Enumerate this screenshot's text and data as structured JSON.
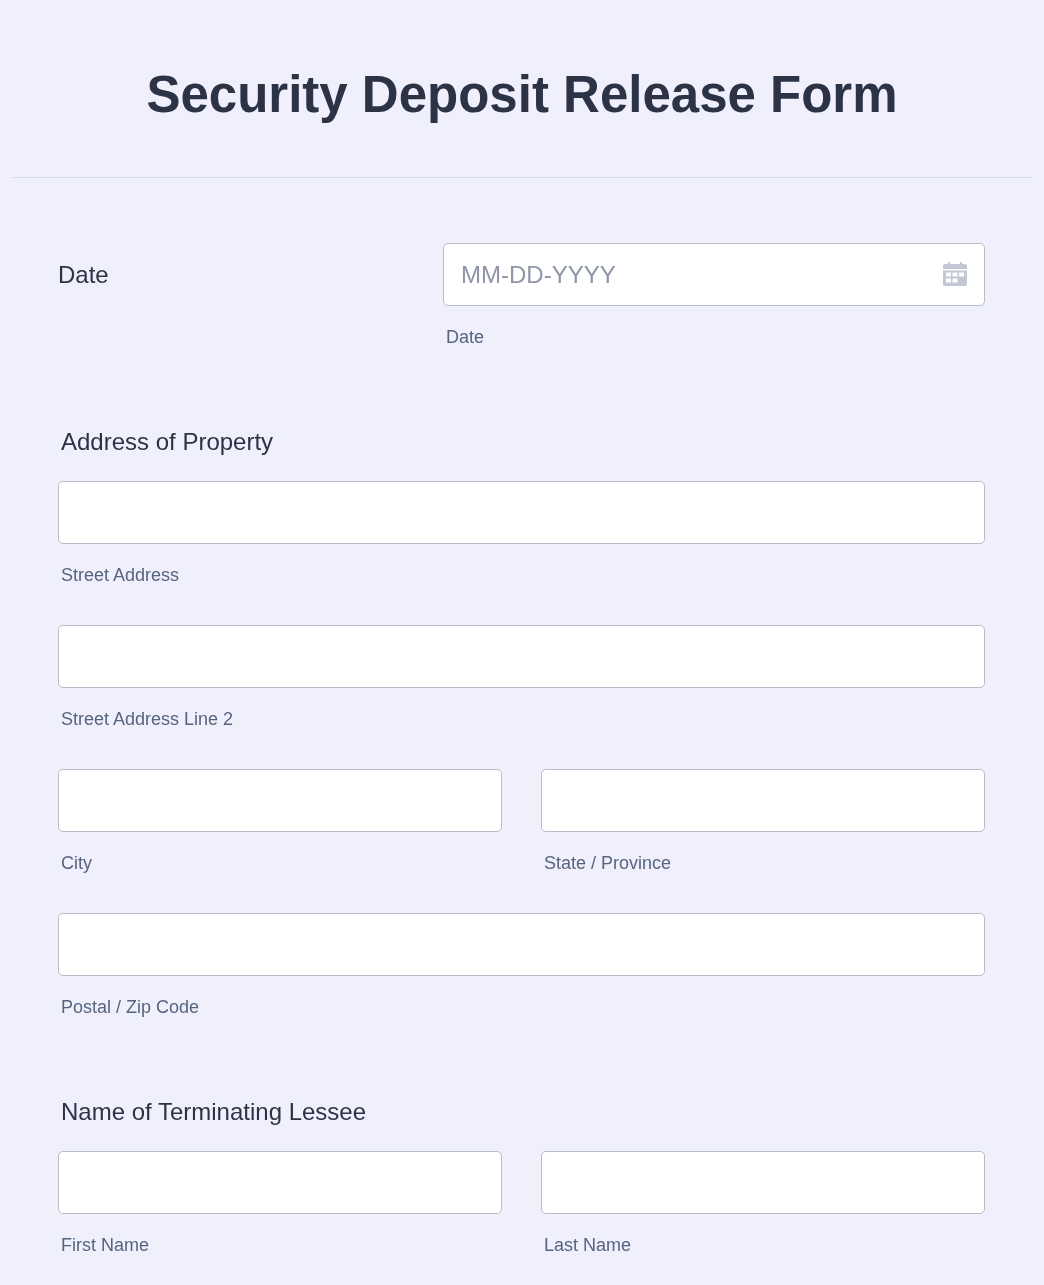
{
  "title": "Security Deposit Release Form",
  "sections": [
    {
      "kind": "inline",
      "label": "Date",
      "rows": [
        [
          {
            "kind": "date",
            "placeholder": "MM-DD-YYYY",
            "sublabel": "Date"
          }
        ]
      ]
    },
    {
      "kind": "stacked",
      "label": "Address of Property",
      "rows": [
        [
          {
            "kind": "text",
            "sublabel": "Street Address"
          }
        ],
        [
          {
            "kind": "text",
            "sublabel": "Street Address Line 2"
          }
        ],
        [
          {
            "kind": "text",
            "sublabel": "City"
          },
          {
            "kind": "text",
            "sublabel": "State / Province"
          }
        ],
        [
          {
            "kind": "text",
            "sublabel": "Postal / Zip Code"
          }
        ]
      ]
    },
    {
      "kind": "stacked",
      "label": "Name of Terminating Lessee",
      "rows": [
        [
          {
            "kind": "text",
            "sublabel": "First Name"
          },
          {
            "kind": "text",
            "sublabel": "Last Name"
          }
        ]
      ]
    }
  ]
}
